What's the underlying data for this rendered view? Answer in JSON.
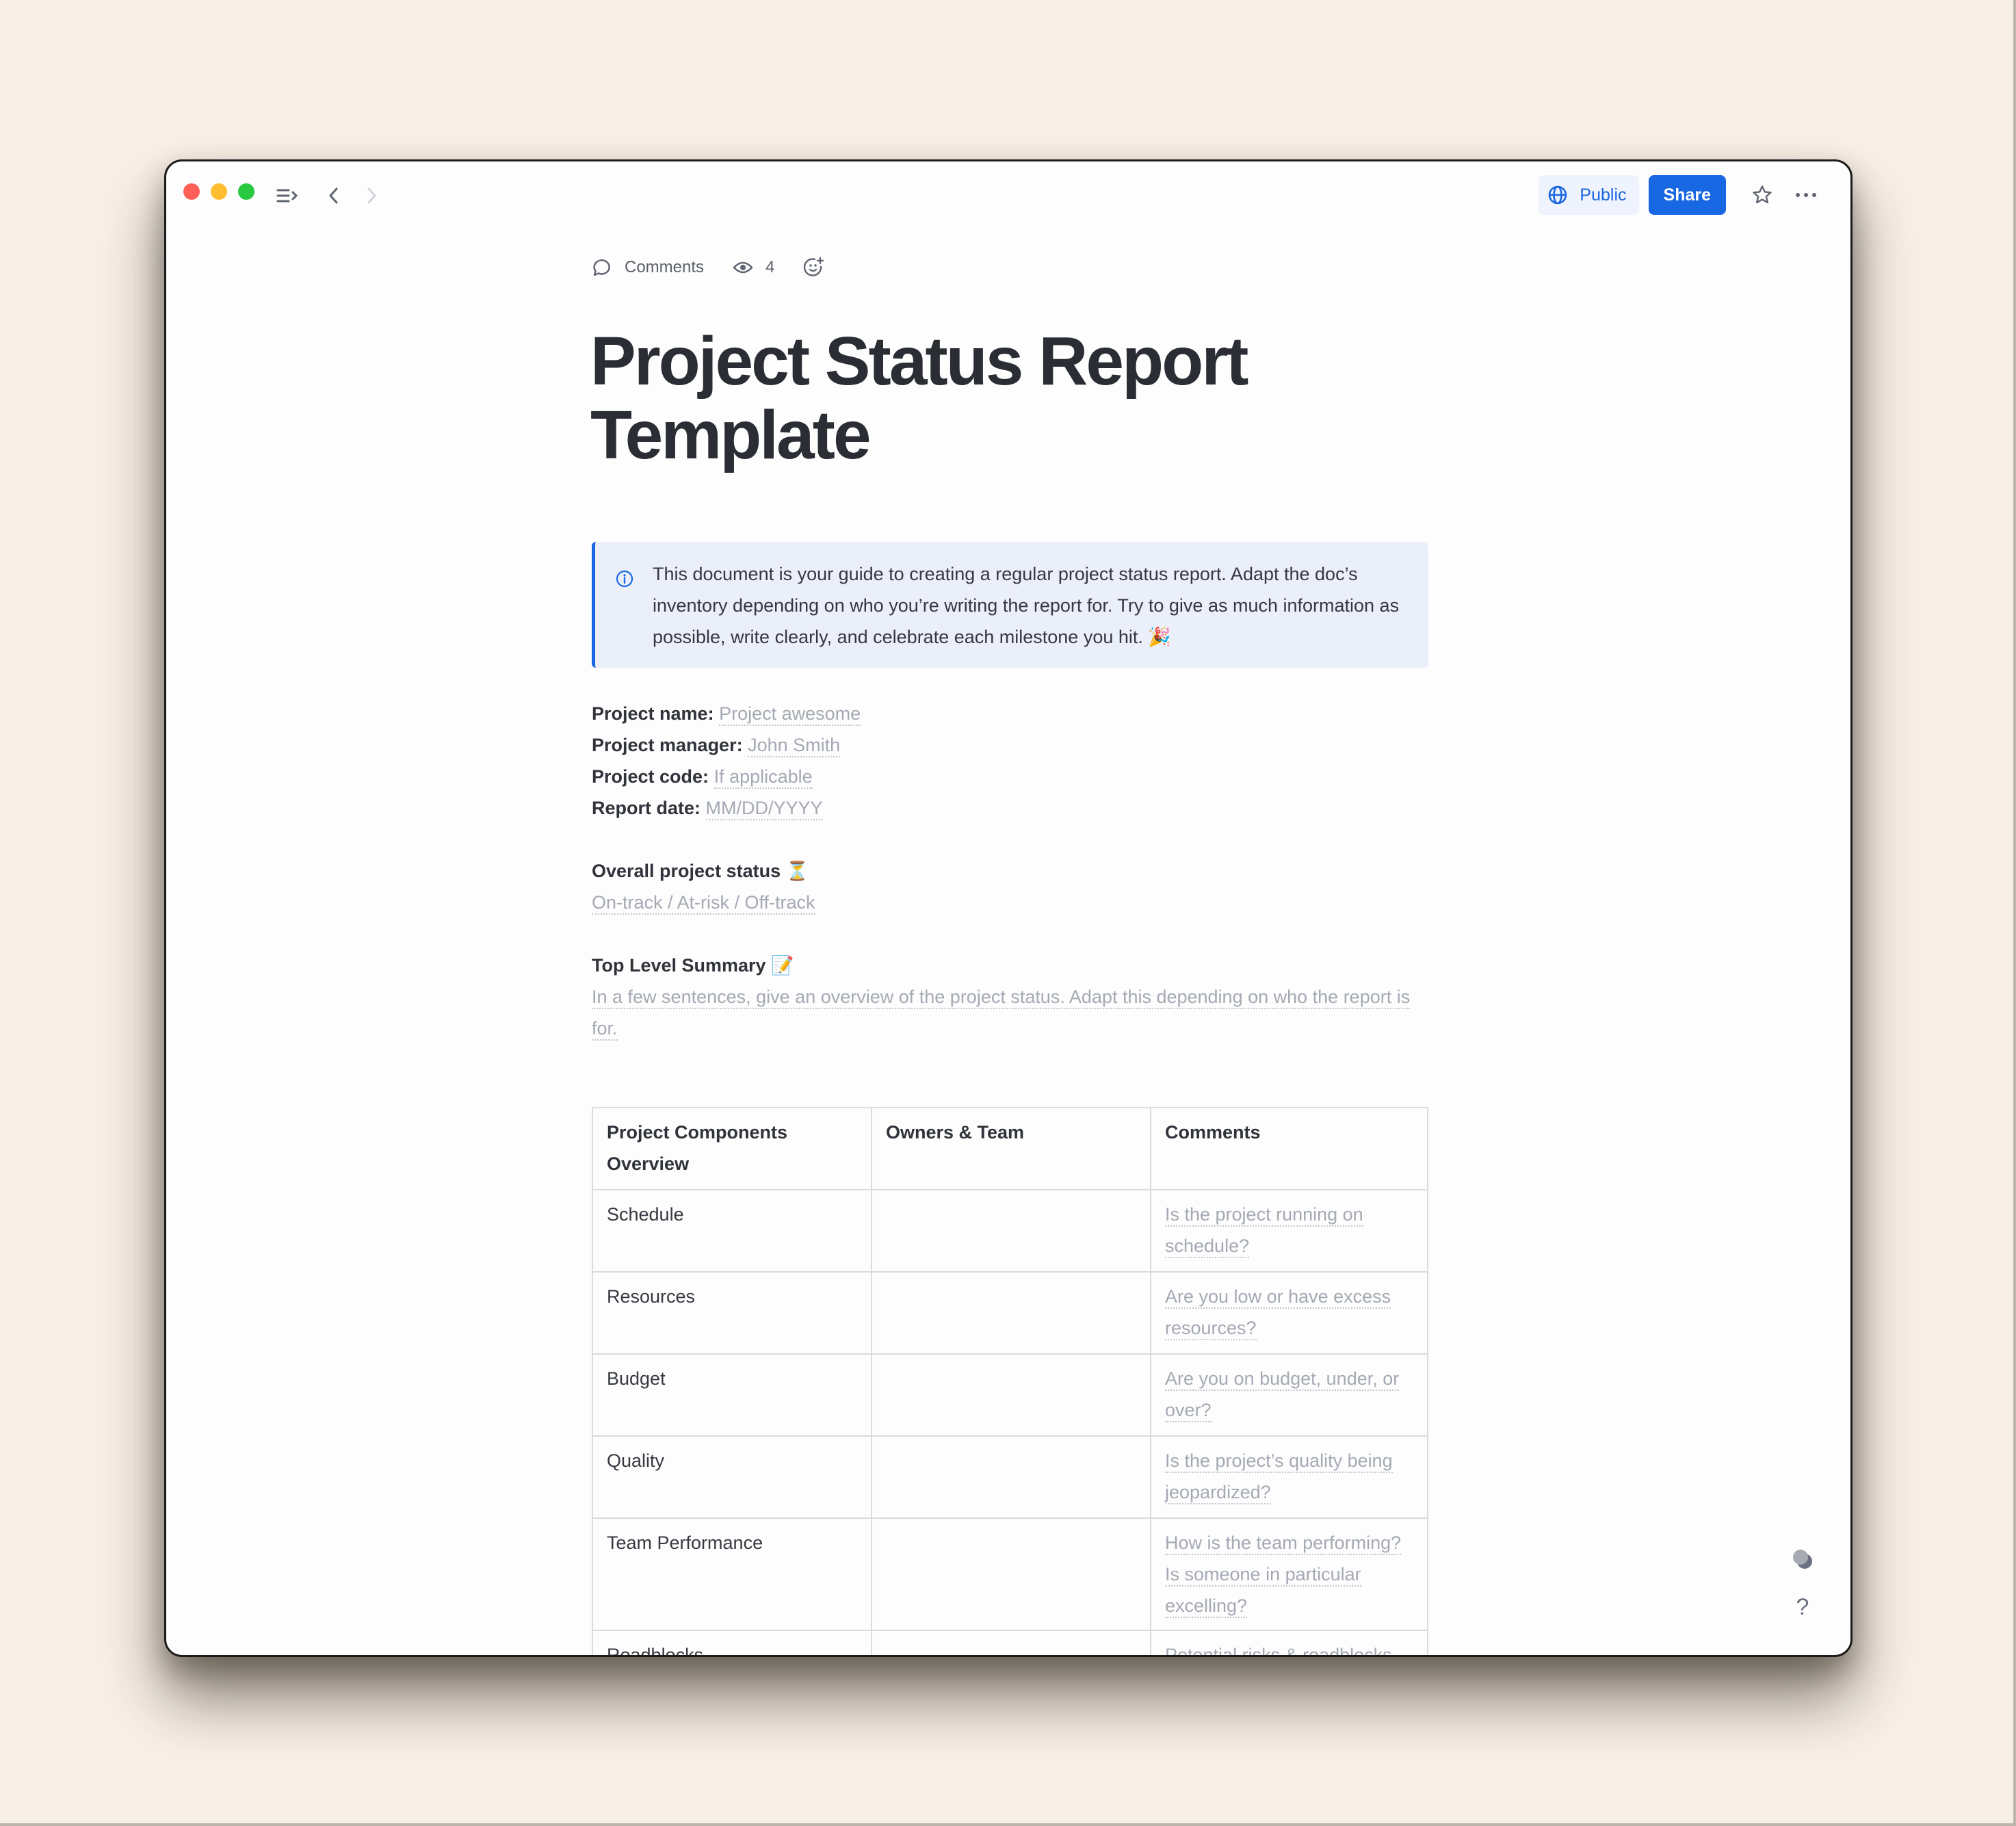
{
  "window": {
    "traffic_lights": [
      "close",
      "minimize",
      "zoom"
    ],
    "toolbar": {
      "sidebar_toggle_icon": "sidebar-expand-icon",
      "back_icon": "chevron-left-icon",
      "forward_icon": "chevron-right-icon",
      "public_label": "Public",
      "share_label": "Share",
      "favorite_icon": "star-icon",
      "more_icon": "ellipsis-icon"
    }
  },
  "doc_meta": {
    "comments_label": "Comments",
    "views_count": "4",
    "reaction_icon": "add-reaction-icon"
  },
  "title": "Project Status Report Template",
  "callout": {
    "icon": "info-icon",
    "text": "This document is your guide to creating a regular project status report. Adapt the doc’s inventory depending on who you’re writing the report for. Try to give as much information as possible, write clearly, and celebrate each milestone you hit. 🎉"
  },
  "fields": [
    {
      "label": "Project name:",
      "placeholder": "Project awesome"
    },
    {
      "label": "Project manager:",
      "placeholder": "John Smith"
    },
    {
      "label": "Project code:",
      "placeholder": "If applicable"
    },
    {
      "label": "Report date:",
      "placeholder": "MM/DD/YYYY"
    }
  ],
  "status_section": {
    "heading": "Overall project status ⏳",
    "placeholder": "On-track / At-risk / Off-track"
  },
  "summary_section": {
    "heading": "Top Level Summary 📝",
    "placeholder": "In a few sentences, give an overview of the project status. Adapt this depending on who the report is for."
  },
  "table": {
    "headers": [
      "Project Components Overview",
      "Owners & Team",
      "Comments"
    ],
    "rows": [
      {
        "component": "Schedule",
        "owners": "",
        "comment": "Is the project running on schedule?"
      },
      {
        "component": "Resources",
        "owners": "",
        "comment": "Are you low or have excess resources?"
      },
      {
        "component": "Budget",
        "owners": "",
        "comment": "Are you on budget, under, or over?"
      },
      {
        "component": "Quality",
        "owners": "",
        "comment": "Is the project’s quality being jeopardized?"
      },
      {
        "component": "Team Performance",
        "owners": "",
        "comment": "How is the team performing? Is someone in particular excelling?"
      },
      {
        "component": "Roadblocks",
        "owners": "",
        "comment": "Potential risks & roadblocks"
      }
    ]
  },
  "side_tools": {
    "theme_icon": "theme-toggle-icon",
    "help_label": "?"
  },
  "colors": {
    "accent": "#1867e3",
    "callout_bg": "#ebeffa",
    "placeholder": "#a4a9b3",
    "page_bg": "#f8efe6"
  }
}
